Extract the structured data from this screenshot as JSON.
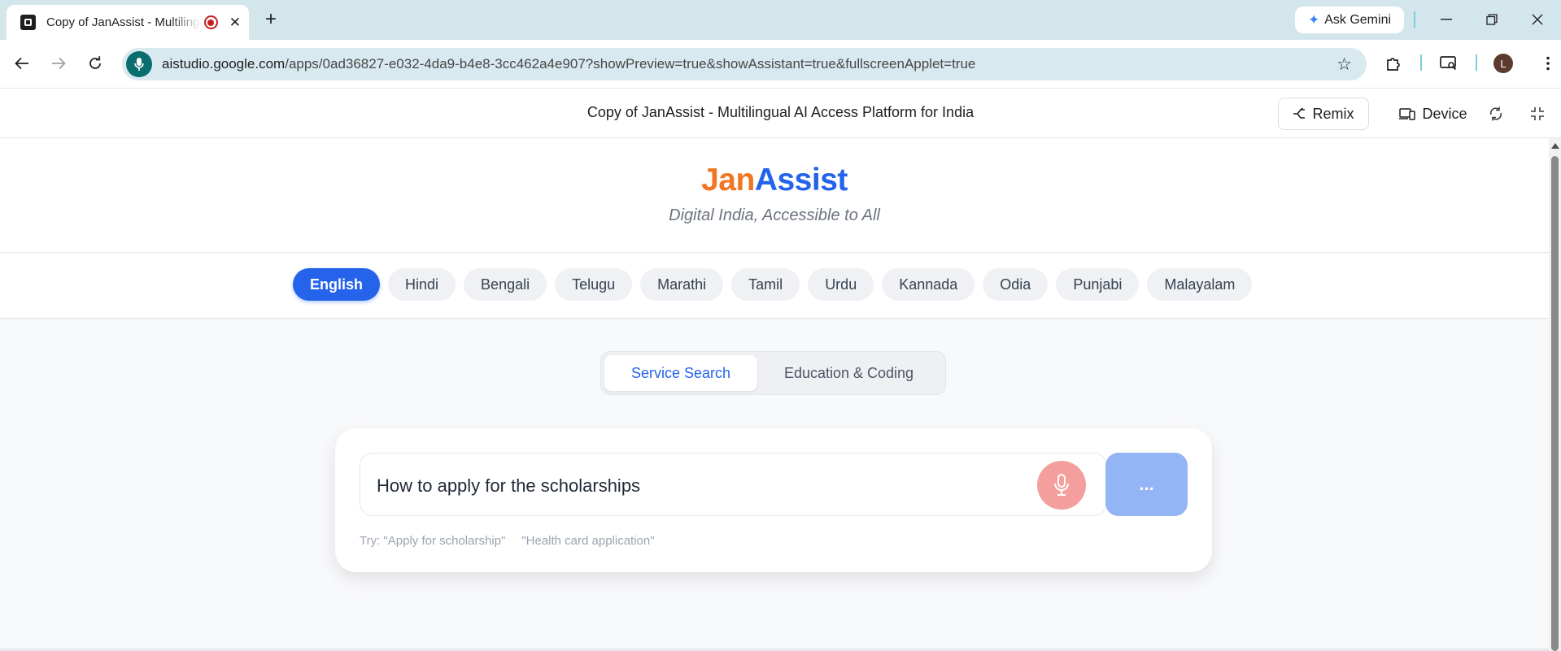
{
  "browser": {
    "tab_title": "Copy of JanAssist - Multilingual AI Access Platform for India",
    "new_tab_icon": "+",
    "ask_gemini_label": "Ask Gemini",
    "url_host": "aistudio.google.com",
    "url_path": "/apps/0ad36827-e032-4da9-b4e8-3cc462a4e907?showPreview=true&showAssistant=true&fullscreenApplet=true",
    "profile_initial": "L"
  },
  "app_header": {
    "title": "Copy of JanAssist - Multilingual AI Access Platform for India",
    "remix_label": "Remix",
    "device_label": "Device"
  },
  "hero": {
    "brand_part1": "Jan",
    "brand_part2": "Assist",
    "tagline": "Digital India, Accessible to All"
  },
  "languages": {
    "active": "English",
    "items": [
      "English",
      "Hindi",
      "Bengali",
      "Telugu",
      "Marathi",
      "Tamil",
      "Urdu",
      "Kannada",
      "Odia",
      "Punjabi",
      "Malayalam"
    ]
  },
  "modes": {
    "active_label": "Service Search",
    "inactive_label": "Education & Coding"
  },
  "search": {
    "value": "How to apply for the scholarships",
    "submit_label": "...",
    "hint_prefix": "Try: \"Apply for scholarship\"",
    "hint_item": "\"Health card application\""
  },
  "colors": {
    "brand_orange": "#f07623",
    "brand_blue": "#2563eb",
    "mic_red": "#f59e9e",
    "submit_blue": "#93b4f5"
  }
}
